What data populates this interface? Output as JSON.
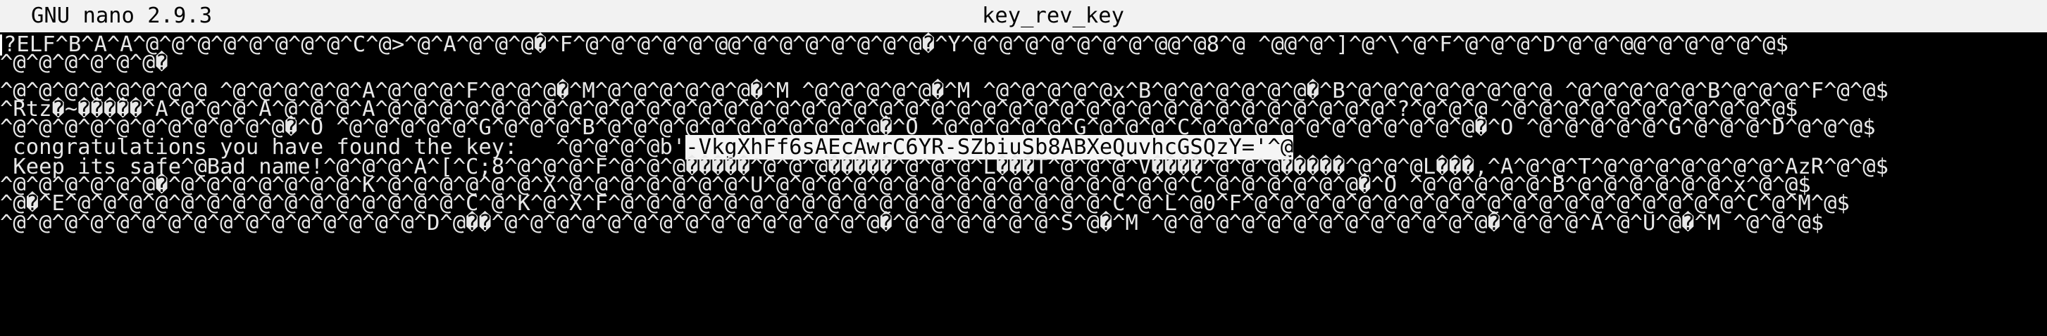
{
  "titlebar": {
    "app_version": "GNU nano 2.9.3",
    "filename": "key_rev_key"
  },
  "editor": {
    "lines": [
      "?ELF^B^A^A^@^@^@^@^@^@^@^@^C^@>^@^A^@^@^@�^F^@^@^@^@^@^@@^@^@^@^@^@^@^@�^Y^@^@^@^@^@^@^@^@@^@8^@ ^@@^@^]^@^\\^@^F^@^@^@^D^@^@^@@^@^@^@^@^@$",
      "^@^@^@^@^@^@�",
      "^@^@^@^@^@^@^@^@ ^@^@^@^@^@^A^@^@^@^F^@^@^@�^M^@^@^@^@^@^@�^M ^@^@^@^@^@�^M ^@^@^@^@^@x^B^@^@^@^@^@^@�^B^@^@^@^@^@^@^@^@ ^@^@^@^@^@^B^@^@^@^F^@^@$",
      "^Rtz�~�����^A^@^@^@^A^@^@^@^A^@^@^@^@^@^@^@^@^@^@^@^@^@^@^@^@^@^@^@^@^@^@^@^@^@^@^@^@^@^@^@^@^@^@^@^@^@^@^@^?^@^@^@ ^@^@^@^@^@^@^@^@^@^@^@$",
      "^@^@^@^@^@^@^@^@^@^@^@�^O ^@^@^@^@^@^G^@^@^@^B^@^@^@^@^@^@^@^@^@^@^@�^O ^@^@^@^@^@^G^@^@^@^C^@^@^@^@^@^@^@^@^@^@^@�^O ^@^@^@^@^@^G^@^@^@^D^@^@^@$",
      " congratulations you have found the key:   ^@^@^@^@b'",
      " Keep its safe^@Bad name!^@^@^@^A^[^C;8^@^@^@^F^@^@^@�����^@^@^@�����^@^@^@^L���T^@^@^@^V����^@^@^@�����^@^@^@L���,^A^@^@^T^@^@^@^@^@^@^@^AzR^@^@$",
      "^@^@^@^@^@^@�^@^@^@^@^@^@^@^K^@^@^@^@^@^@^X^@^@^@^@^@^@^@^U^@^@^@^@^@^@^@^@^@^@^@^@^@^@^@^@^C^@^@^@^@^@^@�^O ^@^@^@^@^@^B^@^@^@^@^@^@^x^@^@$",
      "^@�^E^@^@^@^@^@^@^@^@^@^@^@^@^@^@^@^C^@^K^@^X^F^@^@^@^@^@^@^@^@^@^@^@^@^@^@^@^@^@^@^@^C^@^L^@0^F^@^@^@^@^@^@^@^@^@^@^@^@^@^@^@^@^@^@^@^C^@^M^@$",
      "^@^@^@^@^@^@^@^@^@^@^@^@^@^@^@^@^D^@��^@^@^@^@^@^@^@^@^@^@^@^@^@^@^@�^@^@^@^@^@^@^S^@�^M ^@^@^@^@^@^@^@^@^@^@^@^@^@�^@^@^@^A^@^U^@�^M ^@^@^@$"
    ],
    "key_selection": "-VkgXhFf6sAEcAwrC6YR-SZbiuSb8ABXeQuvhcGSQzY='^@"
  },
  "colors": {
    "background": "#000000",
    "text": "#e8e8e8",
    "titlebar_bg": "#f2f2f2",
    "selection_bg": "#f5f5f5"
  }
}
